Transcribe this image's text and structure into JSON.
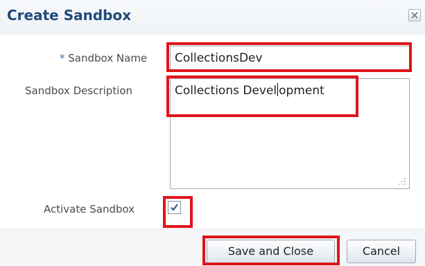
{
  "dialog": {
    "title": "Create Sandbox",
    "close_icon": "close-icon"
  },
  "form": {
    "name_required_marker": "*",
    "name_label": "Sandbox Name",
    "name_value": "CollectionsDev",
    "description_label": "Sandbox Description",
    "description_value_before_caret": "Collections Devel",
    "description_value_after_caret": "opment",
    "activate_label": "Activate Sandbox",
    "activate_checked": true
  },
  "buttons": {
    "save_label": "Save and Close",
    "cancel_label": "Cancel"
  },
  "colors": {
    "title": "#1f4a7a",
    "highlight": "#e0141b",
    "required_marker": "#3a6fa6"
  }
}
